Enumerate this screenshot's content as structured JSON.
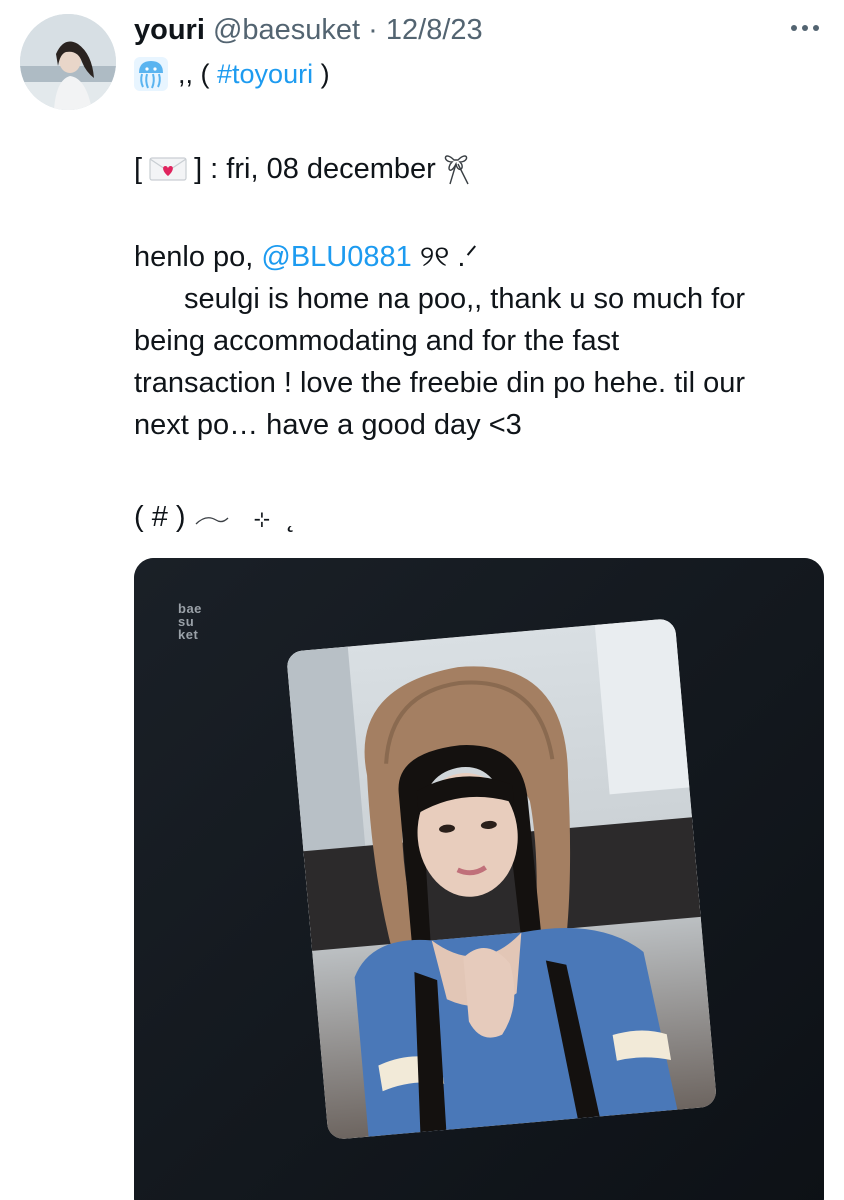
{
  "tweet": {
    "display_name": "youri",
    "handle": "@baesuket",
    "separator": "·",
    "date": "12/8/23",
    "bio_prefix": ",, (",
    "bio_hashtag": "#toyouri",
    "bio_suffix": ")",
    "header_open": "[",
    "header_close": "] : fri, 08 december",
    "greeting_prefix": "henlo po,",
    "mention": "@BLU0881",
    "greeting_suffix": "୨୧ .ᐟ",
    "body_line1": "seulgi is home na poo,, thank u so much for",
    "body_line2": "being accommodating and for the fast",
    "body_line3": "transaction ! love the freebie din po hehe. til our",
    "body_line4": "next po… have a good day <3",
    "tag_line": "( # )",
    "tag_sparkle": "⊹",
    "tag_end": "˛"
  },
  "media": {
    "watermark_line1": "bae",
    "watermark_line2": "su",
    "watermark_line3": "ket"
  },
  "icons": {
    "avatar": "avatar-photo",
    "bio": "jellyfish-icon",
    "letter": "love-letter-icon",
    "bow": "ribbon-bow-icon",
    "more": "more-options-icon"
  },
  "colors": {
    "link": "#1d9bf0",
    "secondary_text": "#536471",
    "primary_text": "#0f1419",
    "media_bg": "#11161c"
  }
}
